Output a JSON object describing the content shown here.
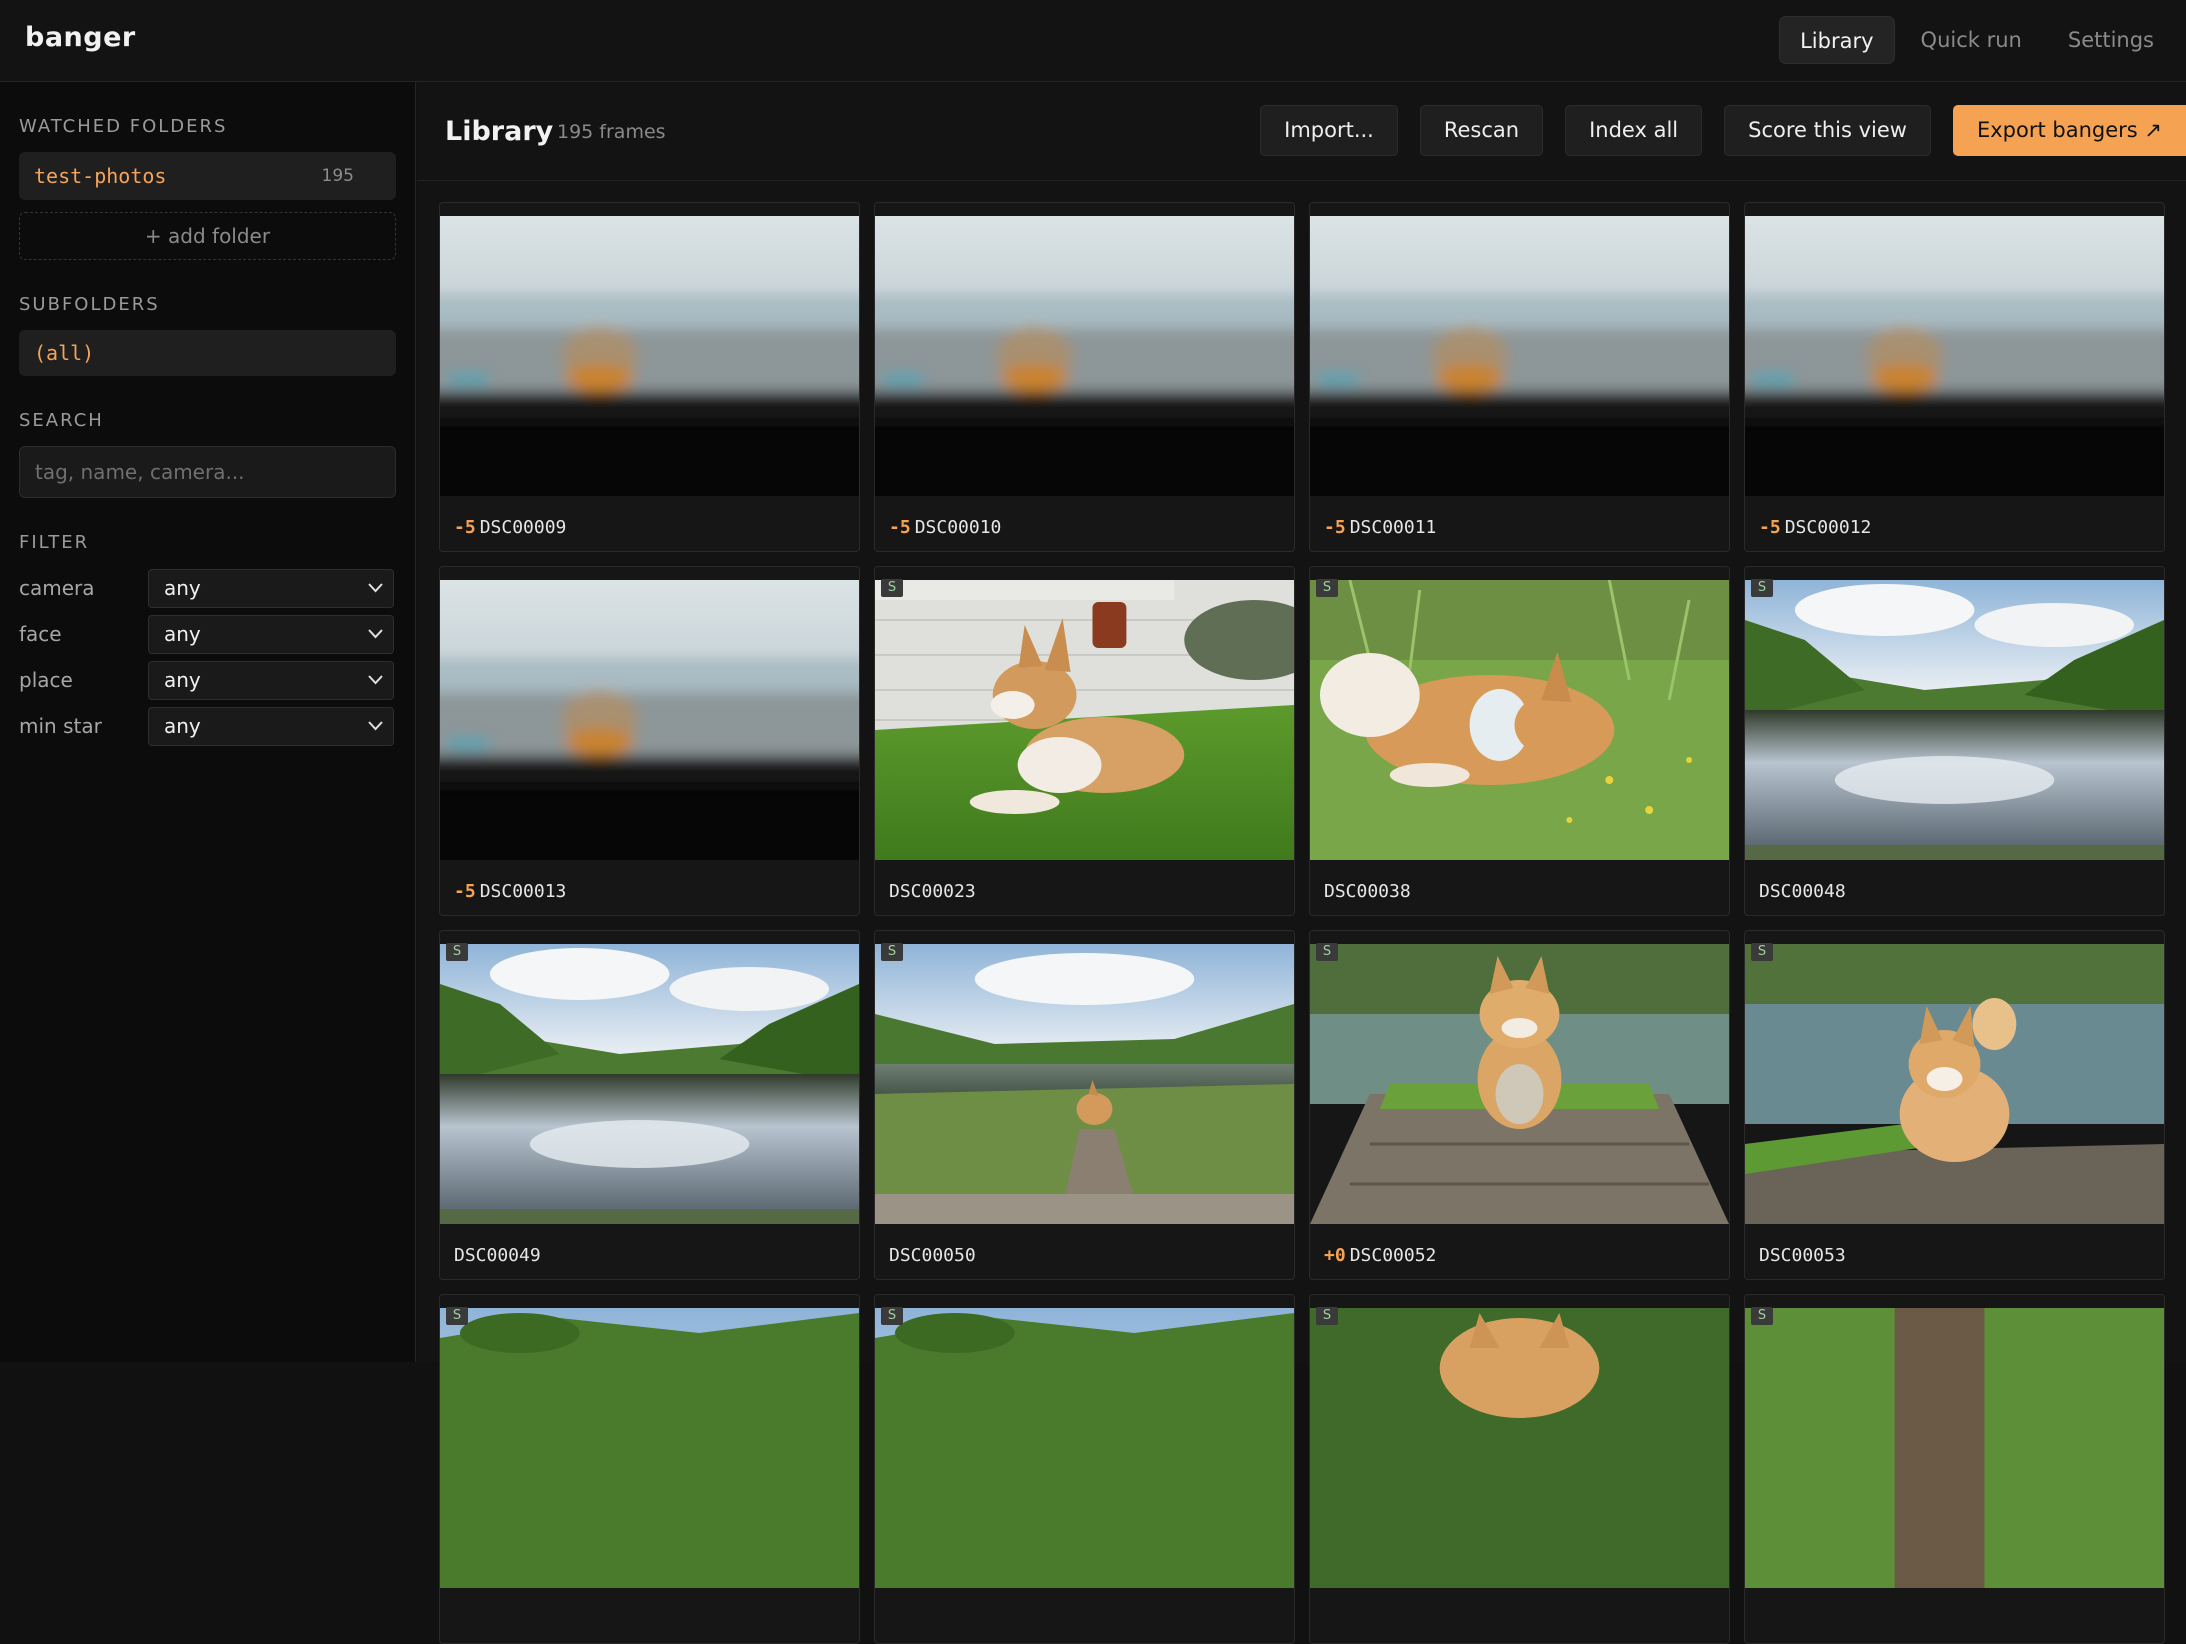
{
  "app": {
    "name": "banger"
  },
  "nav": {
    "tabs": [
      "Library",
      "Quick run",
      "Settings"
    ],
    "active": "Library"
  },
  "sidebar": {
    "watched_title": "WATCHED FOLDERS",
    "folders": [
      {
        "name": "test-photos",
        "count": "195"
      }
    ],
    "add_folder": "+ add folder",
    "subfolders_title": "SUBFOLDERS",
    "subfolders": [
      "(all)"
    ],
    "search_title": "SEARCH",
    "search_placeholder": "tag, name, camera...",
    "filter_title": "FILTER",
    "filters": [
      {
        "label": "camera",
        "value": "any"
      },
      {
        "label": "face",
        "value": "any"
      },
      {
        "label": "place",
        "value": "any"
      },
      {
        "label": "min star",
        "value": "any"
      }
    ]
  },
  "main": {
    "title": "Library",
    "frame_count": "195 frames",
    "buttons": {
      "import": "Import...",
      "rescan": "Rescan",
      "index_all": "Index all",
      "score_view": "Score this view",
      "export": "Export bangers ↗"
    }
  },
  "photos": [
    {
      "name": "DSC00009",
      "score": "-5",
      "badge": "",
      "scene": "blur"
    },
    {
      "name": "DSC00010",
      "score": "-5",
      "badge": "",
      "scene": "blur"
    },
    {
      "name": "DSC00011",
      "score": "-5",
      "badge": "",
      "scene": "blur"
    },
    {
      "name": "DSC00012",
      "score": "-5",
      "badge": "",
      "scene": "blur"
    },
    {
      "name": "DSC00013",
      "score": "-5",
      "badge": "",
      "scene": "blur"
    },
    {
      "name": "DSC00023",
      "score": "",
      "badge": "S",
      "scene": "corgi-wall"
    },
    {
      "name": "DSC00038",
      "score": "",
      "badge": "S",
      "scene": "corgi-grass"
    },
    {
      "name": "DSC00048",
      "score": "",
      "badge": "S",
      "scene": "lake"
    },
    {
      "name": "DSC00049",
      "score": "",
      "badge": "S",
      "scene": "lake"
    },
    {
      "name": "DSC00050",
      "score": "",
      "badge": "S",
      "scene": "lake-dog"
    },
    {
      "name": "DSC00052",
      "score": "+0",
      "badge": "S",
      "scene": "dock-dog"
    },
    {
      "name": "DSC00053",
      "score": "",
      "badge": "S",
      "scene": "dock-dog2"
    },
    {
      "name": "",
      "score": "",
      "badge": "S",
      "scene": "hills"
    },
    {
      "name": "",
      "score": "",
      "badge": "S",
      "scene": "hills"
    },
    {
      "name": "",
      "score": "",
      "badge": "S",
      "scene": "dog-ears"
    },
    {
      "name": "",
      "score": "",
      "badge": "S",
      "scene": "tree"
    }
  ]
}
